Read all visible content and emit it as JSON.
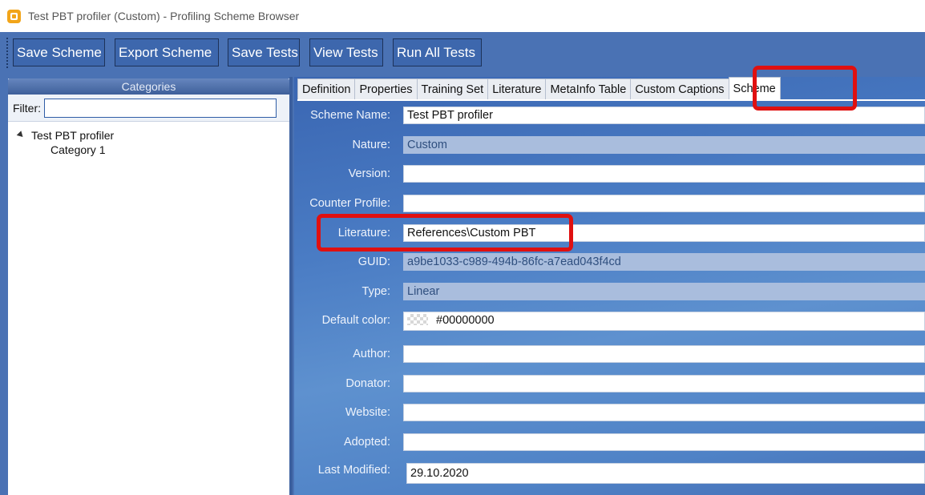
{
  "window": {
    "title": "Test PBT profiler (Custom) - Profiling Scheme Browser",
    "icon": "app-logo-icon"
  },
  "toolbar": {
    "buttons": [
      "Save Scheme",
      "Export Scheme",
      "Save Tests",
      "View Tests",
      "Run All Tests"
    ]
  },
  "categories": {
    "header": "Categories",
    "filter_label": "Filter:",
    "filter_value": "",
    "tree": {
      "root": "Test PBT profiler",
      "children": [
        "Category 1"
      ]
    }
  },
  "tabs": [
    "Definition",
    "Properties",
    "Training Set",
    "Literature",
    "MetaInfo Table",
    "Custom Captions",
    "Scheme"
  ],
  "active_tab": "Scheme",
  "scheme": {
    "fields": [
      {
        "label": "Scheme Name:",
        "value": "Test PBT profiler",
        "readonly": false
      },
      {
        "label": "Nature:",
        "value": "Custom",
        "readonly": true
      },
      {
        "label": "Version:",
        "value": "",
        "readonly": false
      },
      {
        "label": "Counter Profile:",
        "value": "",
        "readonly": false
      },
      {
        "label": "Literature:",
        "value": "References\\Custom PBT",
        "readonly": false
      },
      {
        "label": "GUID:",
        "value": "a9be1033-c989-494b-86fc-a7ead043f4cd",
        "readonly": true
      },
      {
        "label": "Type:",
        "value": "Linear",
        "readonly": true
      },
      {
        "label": "Default color:",
        "value": "#00000000",
        "readonly": false
      },
      {
        "label": "Author:",
        "value": "",
        "readonly": false
      },
      {
        "label": "Donator:",
        "value": "",
        "readonly": false
      },
      {
        "label": "Website:",
        "value": "",
        "readonly": false
      },
      {
        "label": "Adopted:",
        "value": "",
        "readonly": false
      },
      {
        "label": "Last Modified:",
        "value": "29.10.2020",
        "readonly": false
      }
    ]
  },
  "colors": {
    "accent": "#4a72b4",
    "highlight": "#e01010"
  }
}
